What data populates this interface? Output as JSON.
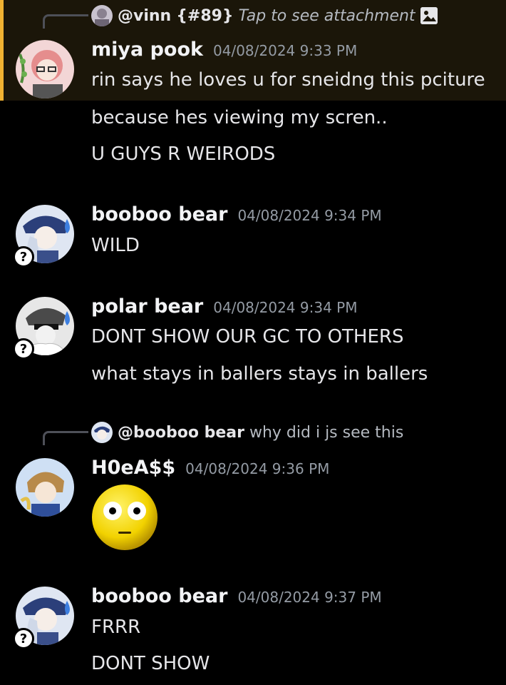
{
  "accent_highlight": "#f0b232",
  "messages": [
    {
      "reply": {
        "mention": "@vinn",
        "tag": "{#89}",
        "text": "Tap to see attachment",
        "attachment_icon": "image-icon"
      },
      "username": "miya pook",
      "timestamp": "04/08/2024 9:33 PM",
      "lines": [
        "rin says he loves u for sneidng this pciture",
        "because hes viewing my scren..",
        "U GUYS R WEIRODS"
      ]
    },
    {
      "username": "booboo bear",
      "timestamp": "04/08/2024 9:34 PM",
      "lines": [
        "WILD"
      ]
    },
    {
      "username": "polar bear",
      "timestamp": "04/08/2024 9:34 PM",
      "lines": [
        "DONT SHOW OUR GC TO OTHERS",
        "what stays in ballers stays in ballers"
      ]
    },
    {
      "reply": {
        "mention": "@booboo bear",
        "text": "why did i js see this"
      },
      "username": "H0eA$$",
      "timestamp": "04/08/2024 9:36 PM",
      "emoji": "flushed-emoji"
    },
    {
      "username": "booboo bear",
      "timestamp": "04/08/2024 9:37 PM",
      "lines": [
        "FRRR",
        "DONT SHOW"
      ]
    }
  ],
  "badge_symbol": "?"
}
